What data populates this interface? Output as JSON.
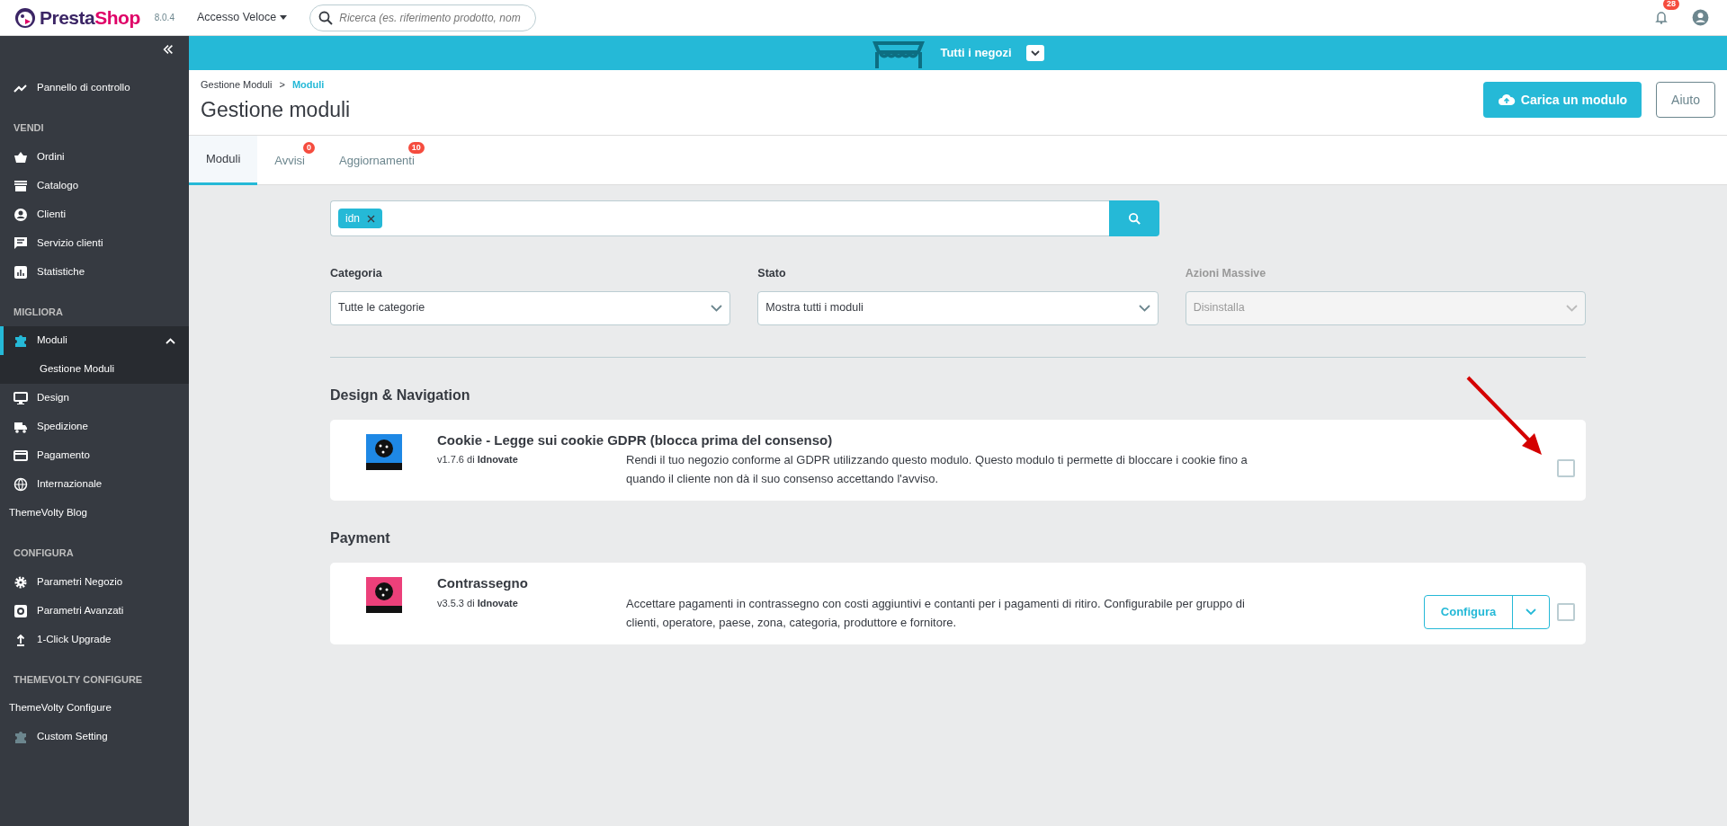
{
  "topbar": {
    "logo_text": "PrestaShop",
    "version": "8.0.4",
    "quick_access": "Accesso Veloce",
    "search": {
      "placeholder": "Ricerca (es. riferimento prodotto, nom"
    },
    "notifications": "28"
  },
  "shop_bar": {
    "label": "Tutti i negozi"
  },
  "sidebar": {
    "sections": [
      {
        "items": [
          {
            "label": "Pannello di controllo",
            "selected": false
          }
        ]
      },
      {
        "title": "VENDI",
        "items": [
          {
            "label": "Ordini",
            "selected": false
          },
          {
            "label": "Catalogo",
            "selected": false
          },
          {
            "label": "Clienti",
            "selected": false
          },
          {
            "label": "Servizio clienti",
            "selected": false
          },
          {
            "label": "Statistiche",
            "selected": false
          }
        ]
      },
      {
        "title": "MIGLIORA",
        "items": [
          {
            "label": "Moduli",
            "selected": true,
            "expanded": true,
            "children": [
              {
                "label": "Gestione Moduli"
              }
            ]
          },
          {
            "label": "Design",
            "selected": false
          },
          {
            "label": "Spedizione",
            "selected": false
          },
          {
            "label": "Pagamento",
            "selected": false
          },
          {
            "label": "Internazionale",
            "selected": false
          },
          {
            "label": "ThemeVolty Blog",
            "selected": false
          }
        ]
      },
      {
        "title": "CONFIGURA",
        "items": [
          {
            "label": "Parametri Negozio",
            "selected": false
          },
          {
            "label": "Parametri Avanzati",
            "selected": false
          },
          {
            "label": "1-Click Upgrade",
            "selected": false
          }
        ]
      },
      {
        "title": "THEMEVOLTY CONFIGURE",
        "items": [
          {
            "label": "ThemeVolty Configure",
            "selected": false
          },
          {
            "label": "Custom Setting",
            "selected": false
          }
        ]
      }
    ]
  },
  "header": {
    "breadcrumb": [
      {
        "label": "Gestione Moduli",
        "selected": false
      },
      {
        "label": "Moduli",
        "selected": true
      }
    ],
    "separator": ">",
    "title": "Gestione moduli",
    "buttons": [
      {
        "label": "Carica un modulo",
        "kind": "primary"
      },
      {
        "label": "Aiuto",
        "kind": "outline"
      }
    ]
  },
  "tabs": [
    {
      "label": "Moduli",
      "selected": true
    },
    {
      "label": "Avvisi",
      "badge": "0",
      "selected": false
    },
    {
      "label": "Aggiornamenti",
      "badge": "10",
      "selected": false
    }
  ],
  "search": {
    "tags": [
      {
        "label": "idn"
      }
    ]
  },
  "filters": [
    {
      "label": "Categoria",
      "value": "Tutte le categorie",
      "disabled": false
    },
    {
      "label": "Stato",
      "value": "Mostra tutti i moduli",
      "disabled": false
    },
    {
      "label": "Azioni Massive",
      "value": "Disinstalla",
      "disabled": true
    }
  ],
  "sections": [
    {
      "title": "Design & Navigation",
      "modules": [
        {
          "name": "Cookie - Legge sui cookie GDPR (blocca prima del consenso)",
          "version": "v1.7.6 di **Idnovate**",
          "description": "Rendi il tuo negozio conforme al GDPR utilizzando questo modulo. Questo modulo ti permette di bloccare i cookie fino a quando il cliente non dà il suo consenso accettando l'avviso.",
          "color": "#1e88e5",
          "checked": false
        }
      ]
    },
    {
      "title": "Payment",
      "modules": [
        {
          "name": "Contrassegno",
          "version": "v3.5.3 di **Idnovate**",
          "description": "Accettare pagamenti in contrassegno con costi aggiuntivi e contanti per i pagamenti di ritiro. Configurabile per gruppo di clienti, operatore, paese, zona, categoria, produttore e fornitore.",
          "color": "#ec407a",
          "checked": false,
          "action": "Configura"
        }
      ]
    }
  ]
}
